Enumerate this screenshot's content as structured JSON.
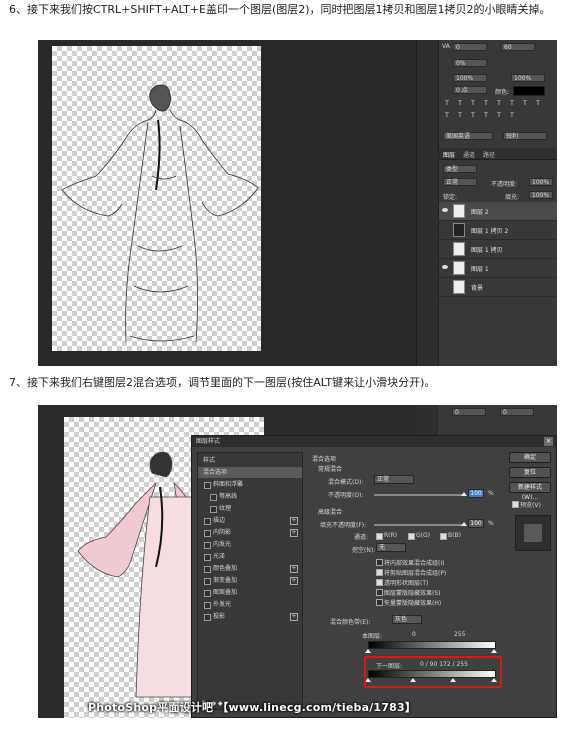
{
  "steps": {
    "step6": "6、接下来我们按CTRL+SHIFT+ALT+E盖印一个图层(图层2)，同时把图层1拷贝和图层1拷贝2的小眼睛关掉。",
    "step7": "7、接下来我们右键图层2混合选项，调节里面的下一图层(按住ALT键来让小滑块分开)。"
  },
  "shot1": {
    "char_panel": {
      "tracking_label": "VA",
      "tracking_value": "0",
      "kerning_value": "60",
      "scale_label": "0%",
      "vscale_value": "100%",
      "hscale_value": "100%",
      "baseline_value": "0 点",
      "color_label": "颜色:",
      "lang_value": "美国英语",
      "aa_value": "锐利"
    },
    "layers_panel": {
      "tabs": [
        "图层",
        "通道",
        "路径"
      ],
      "kind_label": "类型",
      "blend_mode": "正常",
      "opacity_label": "不透明度:",
      "opacity_value": "100%",
      "lock_label": "锁定:",
      "fill_label": "填充:",
      "fill_value": "100%",
      "layers": [
        {
          "name": "图层 2",
          "visible": true,
          "selected": true
        },
        {
          "name": "图层 1 拷贝 2",
          "visible": false,
          "selected": false
        },
        {
          "name": "图层 1 拷贝",
          "visible": false,
          "selected": false
        },
        {
          "name": "图层 1",
          "visible": true,
          "selected": false
        },
        {
          "name": "背景",
          "visible": false,
          "selected": false
        }
      ]
    }
  },
  "shot2": {
    "top_panel": {
      "tracking_value": "0",
      "kerning_value": "0"
    },
    "dialog": {
      "title": "图层样式",
      "close_symbol": "×",
      "style_list": [
        {
          "label": "样式",
          "type": "header"
        },
        {
          "label": "混合选项",
          "type": "active"
        },
        {
          "label": "斜面和浮雕",
          "type": "check",
          "plus": false
        },
        {
          "label": "等高线",
          "type": "sub"
        },
        {
          "label": "纹理",
          "type": "sub"
        },
        {
          "label": "描边",
          "type": "check",
          "plus": true
        },
        {
          "label": "内阴影",
          "type": "check",
          "plus": true
        },
        {
          "label": "内发光",
          "type": "check",
          "plus": false
        },
        {
          "label": "光泽",
          "type": "check",
          "plus": false
        },
        {
          "label": "颜色叠加",
          "type": "check",
          "plus": true
        },
        {
          "label": "渐变叠加",
          "type": "check",
          "plus": true
        },
        {
          "label": "图案叠加",
          "type": "check",
          "plus": false
        },
        {
          "label": "外发光",
          "type": "check",
          "plus": false
        },
        {
          "label": "投影",
          "type": "check",
          "plus": true
        }
      ],
      "fx_label": "fx. ◆ ◆",
      "blend_section": "混合选项",
      "general_section": "常规混合",
      "blend_mode_label": "混合模式(D):",
      "blend_mode_value": "正常",
      "opacity_label": "不透明度(O):",
      "opacity_value": "100",
      "pct": "%",
      "advanced_section": "高级混合",
      "fill_opacity_label": "填充不透明度(F):",
      "fill_opacity_value": "100",
      "channels_label": "通道:",
      "channel_r": "R(R)",
      "channel_g": "G(G)",
      "channel_b": "B(B)",
      "knockout_label": "挖空(N):",
      "knockout_value": "无",
      "opt1": "将内部效果混合成组(I)",
      "opt2": "将剪贴图层混合成组(P)",
      "opt3": "透明形状图层(T)",
      "opt4": "图层蒙版隐藏效果(S)",
      "opt5": "矢量蒙版隐藏效果(H)",
      "blend_if_label": "混合颜色带(E):",
      "blend_if_value": "灰色",
      "this_layer_label": "本图层:",
      "this_layer_min": "0",
      "this_layer_max": "255",
      "under_layer_label": "下一图层:",
      "under_layer_values": "0 / 90    172 / 255",
      "buttons": {
        "ok": "确定",
        "reset": "复位",
        "new_style": "新建样式(W)...",
        "preview": "预览(V)"
      }
    }
  },
  "watermark": "PhotoShop平面设计吧 【www.linecg.com/tieba/1783】",
  "colors": {
    "highlight_red": "#d21c1c",
    "ps_dark": "#383838",
    "selected_blue": "#3d7bd6"
  }
}
